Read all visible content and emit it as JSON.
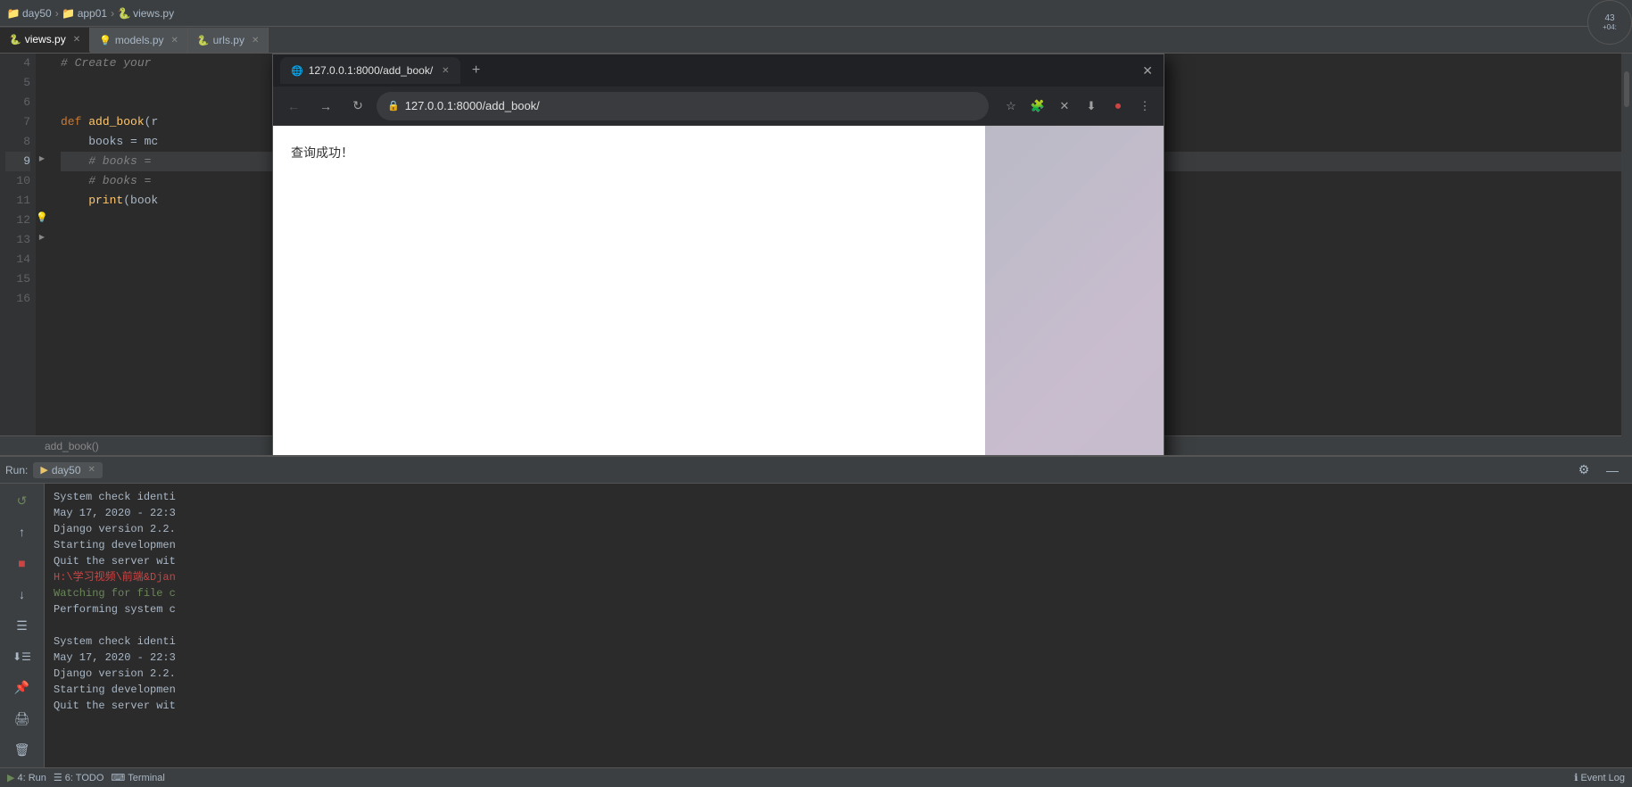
{
  "titlebar": {
    "breadcrumb": [
      {
        "label": "day50",
        "type": "folder"
      },
      {
        "label": "app01",
        "type": "folder"
      },
      {
        "label": "views.py",
        "type": "python"
      }
    ]
  },
  "tabs": [
    {
      "label": "views.py",
      "icon": "python",
      "active": true
    },
    {
      "label": "models.py",
      "icon": "yellow",
      "active": false
    },
    {
      "label": "urls.py",
      "icon": "python",
      "active": false
    }
  ],
  "editor": {
    "lines": [
      {
        "num": 4,
        "content": "    # Create your",
        "type": "comment"
      },
      {
        "num": 5,
        "content": "",
        "type": "normal"
      },
      {
        "num": 6,
        "content": "",
        "type": "normal"
      },
      {
        "num": 7,
        "content": "def add_book(r",
        "type": "code"
      },
      {
        "num": 8,
        "content": "    books = mc",
        "type": "code"
      },
      {
        "num": 9,
        "content": "    # books =",
        "type": "comment",
        "highlighted": true,
        "hasBulb": true
      },
      {
        "num": 10,
        "content": "    # books =",
        "type": "comment",
        "hasFold": true
      },
      {
        "num": 11,
        "content": "    print(book",
        "type": "code"
      },
      {
        "num": 12,
        "content": "",
        "type": "normal"
      },
      {
        "num": 13,
        "content": "",
        "type": "normal"
      },
      {
        "num": 14,
        "content": "",
        "type": "normal"
      },
      {
        "num": 15,
        "content": "",
        "type": "normal"
      },
      {
        "num": 16,
        "content": "",
        "type": "normal"
      }
    ],
    "method_label": "add_book()"
  },
  "browser": {
    "tab": {
      "url": "127.0.0.1:8000/add_book/",
      "full_url": "127.0.0.1:8000/add_book/",
      "label": "127.0.0.1:8000/add_book/"
    },
    "content": "查询成功！"
  },
  "run_panel": {
    "label": "Run:",
    "session": "day50",
    "console_lines": [
      {
        "text": "System check identi",
        "type": "normal"
      },
      {
        "text": "May 17, 2020 - 22:3",
        "type": "normal"
      },
      {
        "text": "Django version 2.2.",
        "type": "normal"
      },
      {
        "text": "Starting developmen",
        "type": "normal"
      },
      {
        "text": "Quit the server wit",
        "type": "normal"
      },
      {
        "text": "H:\\学习视频\\前端&Djan",
        "type": "red"
      },
      {
        "text": "Watching for file c",
        "type": "cyan"
      },
      {
        "text": "Performing system c",
        "type": "normal"
      },
      {
        "text": "",
        "type": "normal"
      },
      {
        "text": "System check identi",
        "type": "normal"
      },
      {
        "text": "May 17, 2020 - 22:3",
        "type": "normal"
      },
      {
        "text": "Django version 2.2.",
        "type": "normal"
      },
      {
        "text": "Starting developmen",
        "type": "normal"
      },
      {
        "text": "Quit the server wit",
        "type": "normal"
      }
    ]
  },
  "status_bar": {
    "run_label": "4: Run",
    "todo_label": "6: TODO",
    "terminal_label": "Terminal",
    "event_log": "Event Log",
    "gear_icon": "⚙"
  },
  "clock": {
    "time": "43",
    "subtitle": "+04:"
  }
}
